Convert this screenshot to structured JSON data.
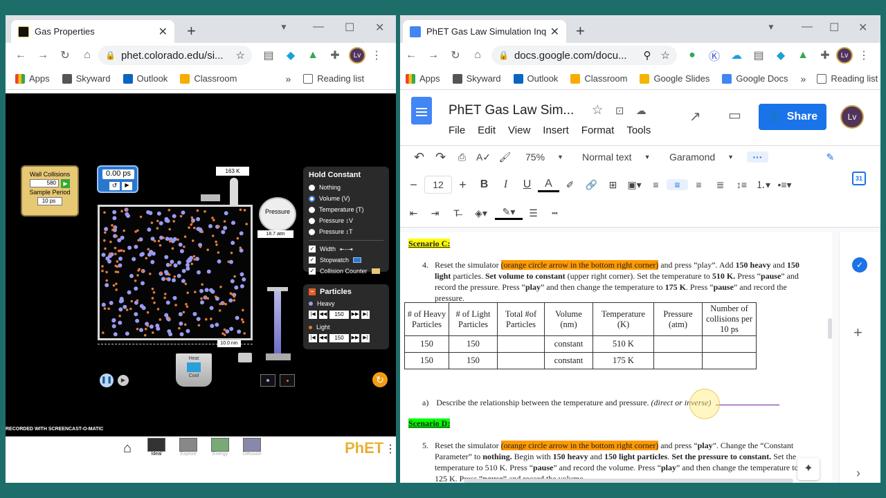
{
  "left": {
    "tab_title": "Gas Properties",
    "url": "phet.colorado.edu/si...",
    "profile": "Lv",
    "bookmarks": [
      "Apps",
      "Skyward",
      "Outlook",
      "Classroom"
    ],
    "reading_list": "Reading list",
    "sim": {
      "wall_collisions_label": "Wall Collisions",
      "wall_collisions_value": "580",
      "sample_period_label": "Sample Period",
      "sample_period_value": "10 ps",
      "stopwatch_value": "0.00 ps",
      "temperature": "163 K",
      "pressure_label": "Pressure",
      "pressure_value": "18.7 atm",
      "width_value": "10.0 nm",
      "heat_label": "Heat",
      "cool_label": "Cool",
      "hold_constant": {
        "title": "Hold Constant",
        "options": [
          "Nothing",
          "Volume (V)",
          "Temperature (T)",
          "Pressure ↕V",
          "Pressure ↕T"
        ],
        "selected_index": 1
      },
      "checkboxes": [
        "Width",
        "Stopwatch",
        "Collision Counter"
      ],
      "particles": {
        "title": "Particles",
        "heavy_label": "Heavy",
        "heavy_count": "150",
        "light_label": "Light",
        "light_count": "150"
      },
      "nav": [
        "Ideal",
        "Explore",
        "Energy",
        "Diffusion"
      ],
      "logo": "PhET",
      "watermark": "RECORDED WITH SCREENCAST-O-MATIC"
    }
  },
  "right": {
    "tab_title": "PhET Gas Law Simulation Inquiry",
    "url": "docs.google.com/docu...",
    "profile": "Lv",
    "bookmarks": [
      "Apps",
      "Skyward",
      "Outlook",
      "Classroom",
      "Google Slides",
      "Google Docs"
    ],
    "reading_list": "Reading list",
    "doc_title": "PhET Gas Law Sim...",
    "menus": [
      "File",
      "Edit",
      "View",
      "Insert",
      "Format",
      "Tools"
    ],
    "share": "Share",
    "zoom": "75%",
    "style": "Normal text",
    "font": "Garamond",
    "font_size": "12",
    "doc": {
      "scenario_c": "Scenario C:",
      "q4_num": "4.",
      "q4_a": "Reset the simulator ",
      "q4_hl": "(orange circle arrow in the bottom right corner)",
      "q4_b": " and press “play”.  Add ",
      "q4_c": "150 heavy",
      "q4_d": " and ",
      "q4_e": "150 light",
      "q4_f": " particles.  ",
      "q4_g": "Set volume to constant",
      "q4_h": " (upper right corner).  Set the temperature to ",
      "q4_i": "510 K.",
      "q4_j": "  Press “",
      "q4_k": "pause",
      "q4_l": "” and record the pressure.  Press “",
      "q4_m": "play",
      "q4_n": "” and then change the temperature to ",
      "q4_o": "175 K",
      "q4_p": ".  Press “",
      "q4_q": "pause",
      "q4_r": "” and record the pressure.",
      "table_headers": [
        "# of Heavy Particles",
        "# of Light Particles",
        "Total #of Particles",
        "Volume (nm)",
        "Temperature (K)",
        "Pressure (atm)",
        "Number of collisions per 10 ps"
      ],
      "table_rows": [
        [
          "150",
          "150",
          "",
          "constant",
          "510 K",
          "",
          ""
        ],
        [
          "150",
          "150",
          "",
          "constant",
          "175 K",
          "",
          ""
        ]
      ],
      "qa_label": "a)",
      "qa_text": "Describe the relationship between the temperature and pressure. ",
      "qa_hint": "(direct or inverse)",
      "scenario_d": "Scenario D:",
      "q5_num": "5.",
      "q5_a": "Reset the simulator ",
      "q5_hl": "(orange circle arrow in the bottom right corner)",
      "q5_b": " and press “",
      "q5_c": "play",
      "q5_d": "”. Change the “Constant Parameter” to ",
      "q5_e": "nothing.",
      "q5_f": "  Begin with ",
      "q5_g": "150 heavy",
      "q5_h": " and ",
      "q5_i": "150 light particles",
      "q5_j": ".  ",
      "q5_k": "Set the pressure to constant.",
      "q5_l": "  Set the temperature to 510 K.  Press “",
      "q5_m": "pause",
      "q5_n": "” and record the volume.  Press “",
      "q5_o": "play",
      "q5_p": "” and then change the temperature to 125 K. Press “",
      "q5_q": "pause",
      "q5_r": "” and record the volume."
    }
  },
  "colors": {
    "docs_blue": "#1a73e8",
    "orange_highlight": "#ff9900",
    "yellow_highlight": "#ffff00",
    "green_highlight": "#00ff00"
  }
}
